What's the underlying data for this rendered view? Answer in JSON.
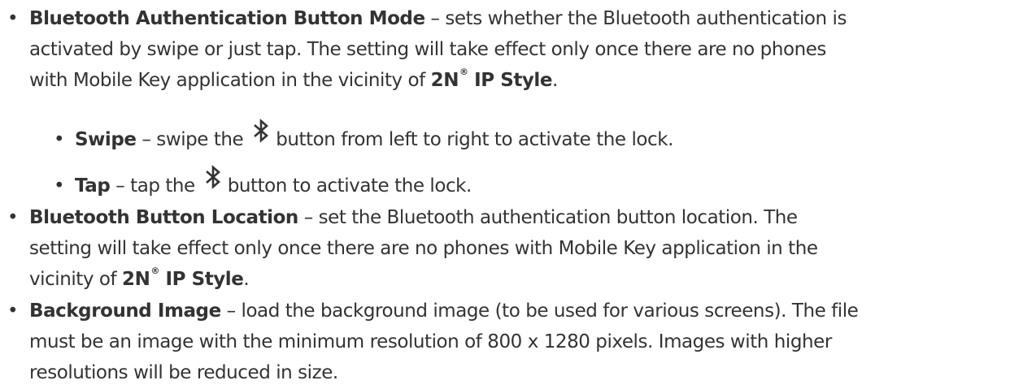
{
  "bullet_char": "•",
  "items": [
    {
      "term": "Bluetooth Authentication Button Mode",
      "dash": " – ",
      "text_l1": "sets whether the Bluetooth authentication is",
      "text_l2": "activated by swipe or just tap. The setting will take effect only once there are no phones",
      "text_l3": "with Mobile Key application in the vicinity of ",
      "product_prefix": "2N",
      "registered_mark": "®",
      "product_suffix": " IP Style",
      "end": "."
    },
    {
      "term": "Swipe",
      "dash": " – ",
      "text_before_icon": "swipe the",
      "icon": "bluetooth-icon",
      "text_after_icon": "button from left to right to activate the lock."
    },
    {
      "term": "Tap",
      "dash": " – ",
      "text_before_icon": "tap the",
      "icon": "bluetooth-icon",
      "text_after_icon": "button to activate the lock."
    },
    {
      "term": "Bluetooth Button Location",
      "dash": " – ",
      "text_l1": "set the Bluetooth authentication button location. The",
      "text_l2": "setting will take effect only once there are no phones with Mobile Key application in the",
      "text_l3": "vicinity of ",
      "product_prefix": "2N",
      "registered_mark": "®",
      "product_suffix": " IP Style",
      "end": "."
    },
    {
      "term": "Background Image",
      "dash": " – ",
      "text_l1": "load the background image (to be used for various screens). The file",
      "text_l2": "must be an image with the minimum resolution of 800 x 1280 pixels. Images with higher",
      "text_l3": "resolutions will be reduced in size."
    }
  ],
  "colors": {
    "text": "#333333",
    "background": "#ffffff"
  }
}
